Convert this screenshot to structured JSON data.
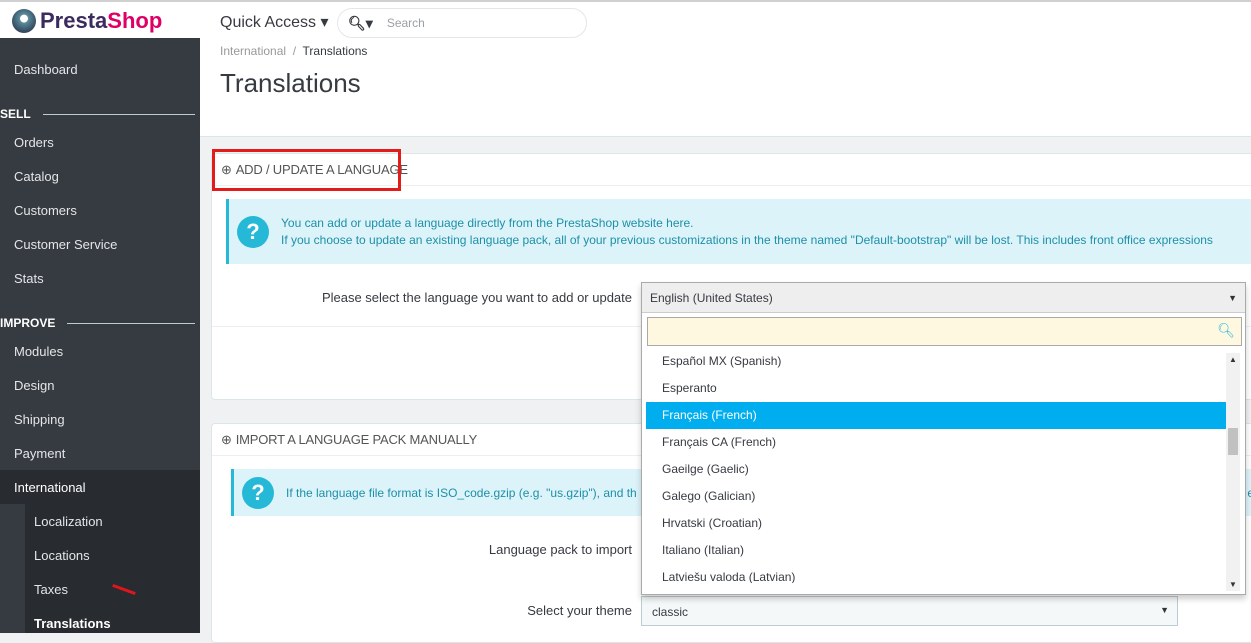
{
  "header": {
    "logo_text_1": "Presta",
    "logo_text_2": "Shop",
    "quick_access": "Quick Access ▾",
    "search_placeholder": "Search"
  },
  "sidebar": {
    "dashboard": "Dashboard",
    "sell_title": "SELL",
    "sell_items": [
      "Orders",
      "Catalog",
      "Customers",
      "Customer Service",
      "Stats"
    ],
    "improve_title": "IMPROVE",
    "improve_items": [
      "Modules",
      "Design",
      "Shipping",
      "Payment"
    ],
    "international": "International",
    "international_sub": [
      "Localization",
      "Locations",
      "Taxes",
      "Translations"
    ]
  },
  "page": {
    "breadcrumb_parent": "International",
    "breadcrumb_sep": "/",
    "breadcrumb_current": "Translations",
    "title": "Translations"
  },
  "add_panel": {
    "title": "ADD / UPDATE A LANGUAGE",
    "info_line1": "You can add or update a language directly from the PrestaShop website here.",
    "info_line2": "If you choose to update an existing language pack, all of your previous customizations in the theme named \"Default-bootstrap\" will be lost. This includes front office expressions",
    "select_label": "Please select the language you want to add or update",
    "selected": "English (United States)",
    "search_value": "",
    "options": [
      "Español MX (Spanish)",
      "Esperanto",
      "Français (French)",
      "Français CA (French)",
      "Gaeilge (Gaelic)",
      "Galego (Galician)",
      "Hrvatski (Croatian)",
      "Italiano (Italian)",
      "Latviešu valoda (Latvian)"
    ],
    "highlighted": "Français (French)"
  },
  "import_panel": {
    "title": "IMPORT A LANGUAGE PACK MANUALLY",
    "info": "If the language file format is ISO_code.gzip (e.g. \"us.gzip\"), and th",
    "info_tail": "e",
    "pack_label": "Language pack to import",
    "theme_label": "Select your theme",
    "theme_value": "classic"
  },
  "colors": {
    "sidebar": "#363a41",
    "accent": "#25b9d7",
    "highlight": "#00aeef",
    "annotation": "#e21b1b"
  }
}
